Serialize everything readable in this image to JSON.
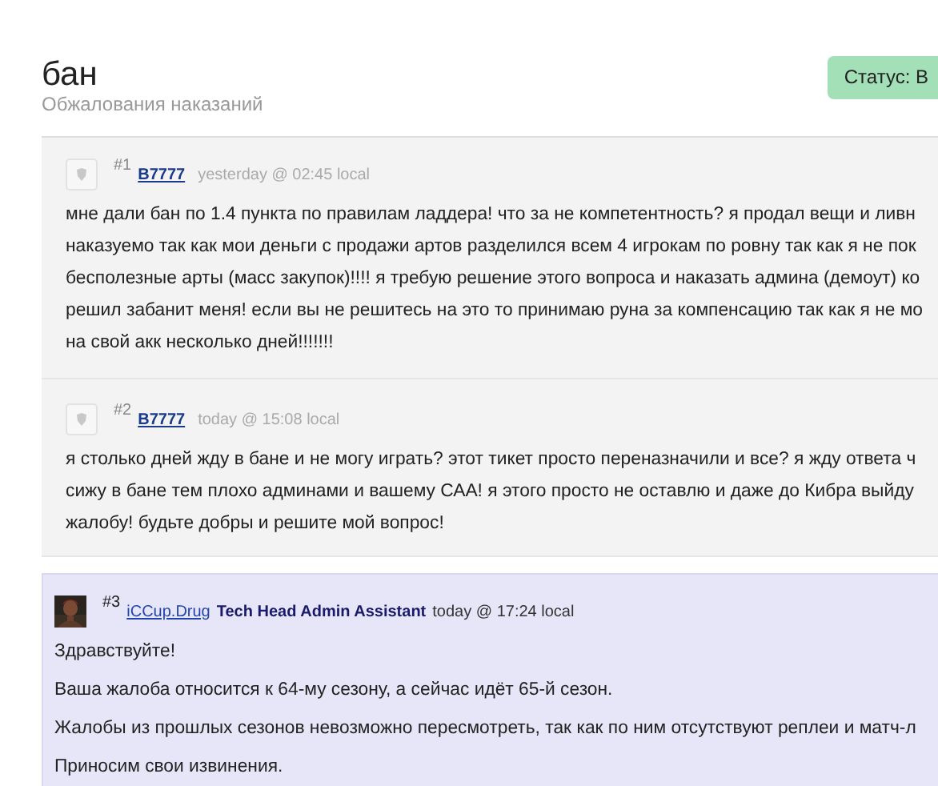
{
  "header": {
    "title": "бан",
    "subtitle": "Обжалования наказаний",
    "status": "Статус: В"
  },
  "posts": [
    {
      "kind": "user",
      "number": "#1",
      "author": "B7777",
      "time": "yesterday @ 02:45 local",
      "lines": [
        "мне дали бан по 1.4 пункта по правилам ладдера! что за не компетентность? я продал вещи и ливн",
        "наказуемо так как мои деньги с продажи артов разделился всем 4 игрокам по ровну так как я не пок",
        "бесполезные арты (масс закупок)!!!! я требую решение этого вопроса и наказать админа (демоут) ко",
        "решил забанит меня! если вы не решитесь на это то принимаю руна за компенсацию так как я не мо",
        "на свой акк несколько дней!!!!!!!"
      ]
    },
    {
      "kind": "user",
      "number": "#2",
      "author": "B7777",
      "time": "today @ 15:08 local",
      "lines": [
        "я столько дней жду в бане и не могу играть? этот тикет просто переназначили и все? я жду ответа ч",
        "сижу в бане тем плохо админами и вашему САА! я этого просто не оставлю и даже до Кибра выйду",
        "жалобу! будьте добры и решите мой вопрос!"
      ]
    },
    {
      "kind": "staff",
      "number": "#3",
      "author": "iCCup.Drug",
      "role": "Tech Head Admin Assistant",
      "time": "today @ 17:24 local",
      "lines": [
        "Здравствуйте!",
        "Ваша жалоба относится к 64-му сезону, а сейчас идёт 65-й сезон.",
        "Жалобы из прошлых сезонов невозможно пересмотреть, так как по ним отсутствуют реплеи и матч-л",
        "Приносим свои извинения."
      ]
    }
  ]
}
